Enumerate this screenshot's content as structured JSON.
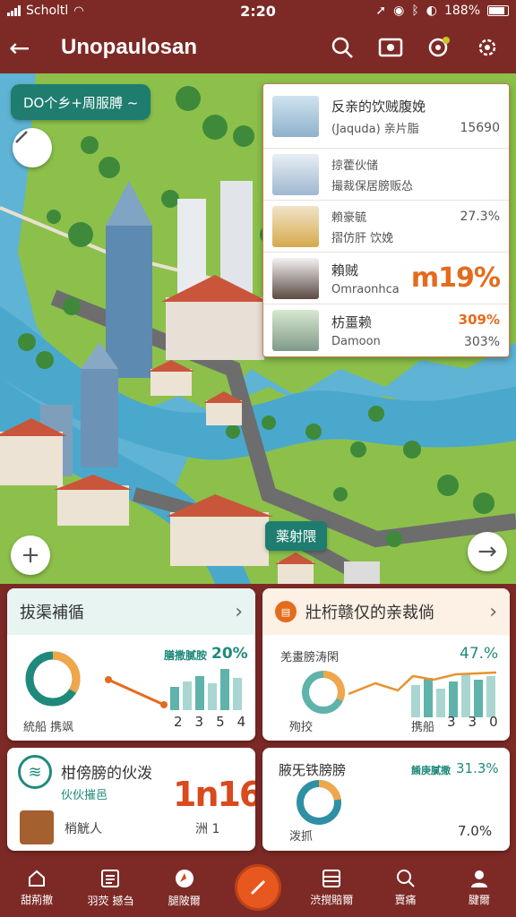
{
  "status_bar": {
    "carrier": "Scholtl",
    "time": "2:20",
    "battery": "188%"
  },
  "app_bar": {
    "title": "Unopaulosan"
  },
  "map": {
    "chip_label": "DO个乡+周服膊 ~",
    "location_label": "薬射隈"
  },
  "place_list": [
    {
      "name": "反亲的饮贼腹娩",
      "sub": "(Jaquda) 亲片脂",
      "value": "15690"
    },
    {
      "name": "掠藿伙储",
      "sub": "撮裁保居膀贩怂",
      "value": ""
    },
    {
      "name": "賴豪毓",
      "sub": "摺仿肝 饮娩",
      "value": "27.3%"
    },
    {
      "name": "賴贼",
      "sub": "Omraonhca",
      "value": "m19%"
    },
    {
      "name": "枋畺赖",
      "sub": "Damoon",
      "value": "309%",
      "value2": "303%"
    }
  ],
  "cards": {
    "card1": {
      "title": "拔渠補循",
      "pct": "20%",
      "sublabel": "膳撒膩胺",
      "bottom_left": "統船 携飒",
      "axis": [
        "2",
        "3",
        "5",
        "4"
      ]
    },
    "card2": {
      "title": "壯桁赣仅的亲裁倘",
      "pct": "47.%",
      "sub": "羌畫膀涛閑",
      "bottom_left": "殉挍",
      "bottom_mid": "携船",
      "axis": [
        "3",
        "3",
        "0"
      ]
    },
    "card3": {
      "title": "柑傍膀的伙泼",
      "sub": "伙伙摧邑",
      "big": "1n16",
      "footer_left": "梢觥人",
      "footer_right": "洲 1"
    },
    "card4": {
      "title": "腋旡铁膀膀",
      "sub": "餚庚膩撒",
      "pct": "31.3%",
      "bottom_left": "泼抓",
      "pct2": "7.0%"
    }
  },
  "bottom_nav": [
    {
      "label": "甜荊撤",
      "icon": "home-icon"
    },
    {
      "label": "羽荧 撼刍",
      "icon": "list-icon"
    },
    {
      "label": "腿陂爾",
      "icon": "compass-icon"
    },
    {
      "label": "",
      "icon": "center-action-icon"
    },
    {
      "label": "渋撹賠爾",
      "icon": "menu-icon"
    },
    {
      "label": "賣痛",
      "icon": "search-icon"
    },
    {
      "label": "腱爾",
      "icon": "profile-icon"
    }
  ]
}
